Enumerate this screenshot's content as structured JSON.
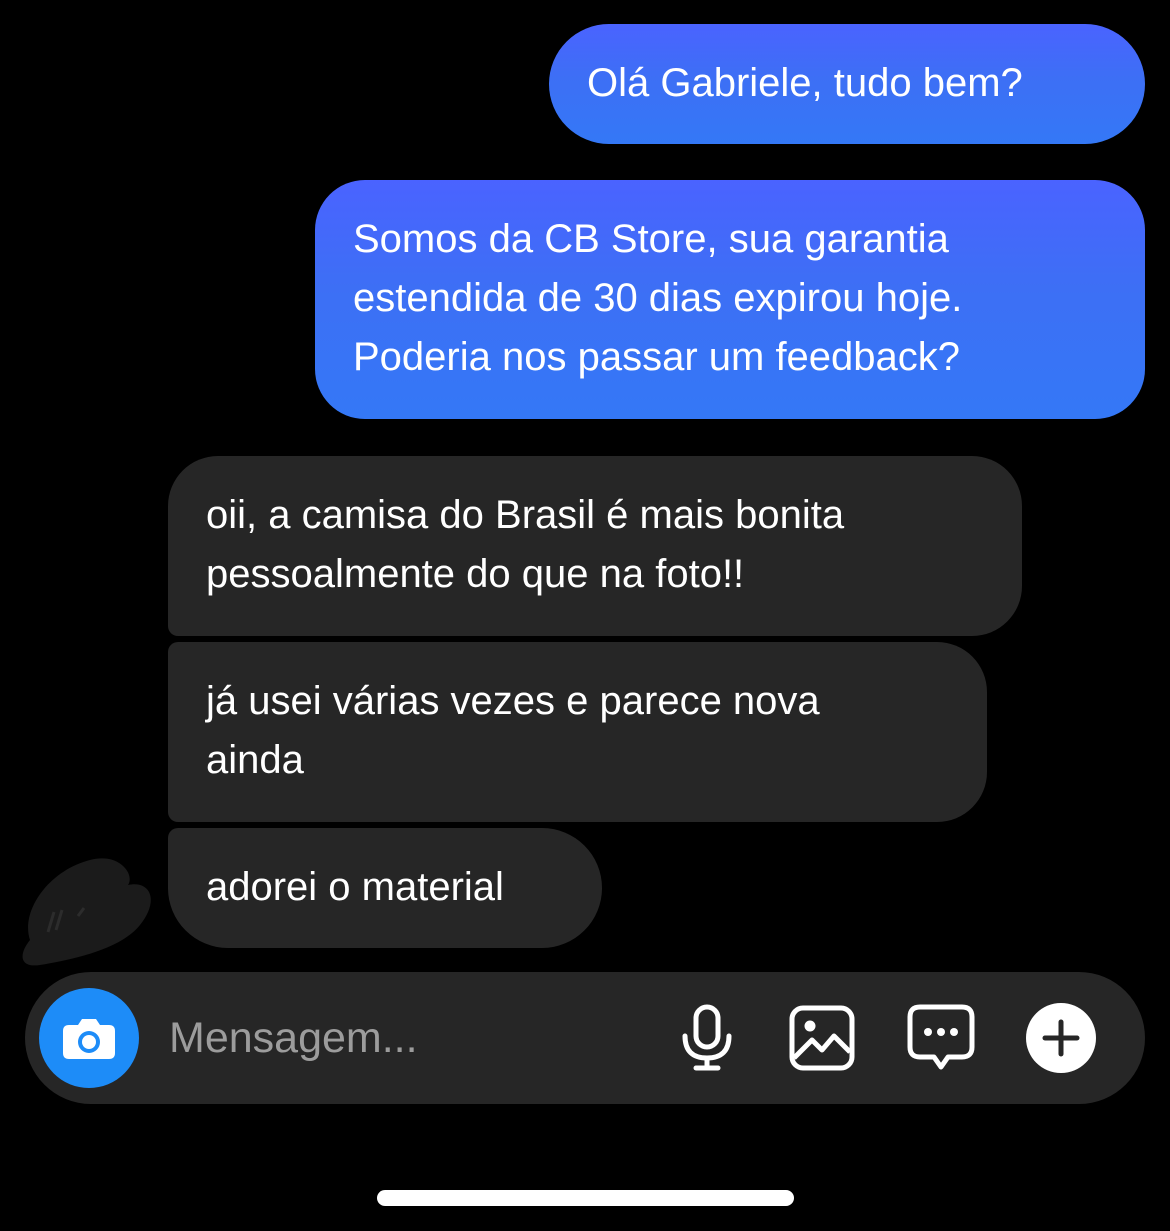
{
  "conversation": {
    "messages": [
      {
        "direction": "sent",
        "text": "Olá Gabriele, tudo bem?"
      },
      {
        "direction": "sent",
        "text": "Somos da CB Store, sua garantia\nestendida de 30 dias expirou hoje.\nPoderia nos passar um feedback?"
      },
      {
        "direction": "received",
        "text": "oii, a camisa do Brasil é mais bonita\npessoalmente do que na foto!!"
      },
      {
        "direction": "received",
        "text": "já usei várias vezes e parece nova\nainda"
      },
      {
        "direction": "received",
        "text": "adorei o material"
      }
    ]
  },
  "composer": {
    "placeholder": "Mensagem...",
    "icons": [
      "camera-icon",
      "microphone-icon",
      "gallery-icon",
      "sticker-icon",
      "plus-icon"
    ]
  },
  "colors": {
    "background": "#000000",
    "sent_bubble": "#3d6ff5",
    "received_bubble": "#262626",
    "camera_button": "#1d8cf8",
    "placeholder_text": "#9c9c9c"
  }
}
